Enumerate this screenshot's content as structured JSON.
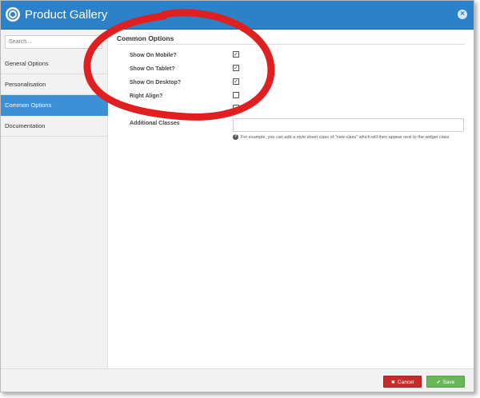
{
  "window": {
    "title": "Product Gallery"
  },
  "sidebar": {
    "search_placeholder": "Search...",
    "items": [
      {
        "label": "General Options",
        "active": false
      },
      {
        "label": "Personalisation",
        "active": false
      },
      {
        "label": "Common Options",
        "active": true
      },
      {
        "label": "Documentation",
        "active": false
      }
    ]
  },
  "main": {
    "section_title": "Common Options",
    "options": [
      {
        "label": "Show On Mobile?",
        "checked": true
      },
      {
        "label": "Show On Tablet?",
        "checked": true
      },
      {
        "label": "Show On Desktop?",
        "checked": true
      },
      {
        "label": "Right Align?",
        "checked": false
      }
    ],
    "additional_classes": {
      "label": "Additional Classes",
      "value": "",
      "help_text": "For example, you can add a style sheet class of \"new-class\" which will then appear next to the widget class"
    }
  },
  "footer": {
    "cancel_label": "Cancel",
    "save_label": "Save"
  },
  "colors": {
    "titlebar": "#2c81c9",
    "active_nav": "#3d8fd6",
    "cancel": "#c62b2b",
    "save": "#6ab75a",
    "annotation": "#e02020"
  },
  "icons": {
    "title": "gear-circle-icon",
    "close": "close-circle-icon",
    "help": "help-circle-icon",
    "cancel": "x-circle-icon",
    "save": "check-icon"
  }
}
